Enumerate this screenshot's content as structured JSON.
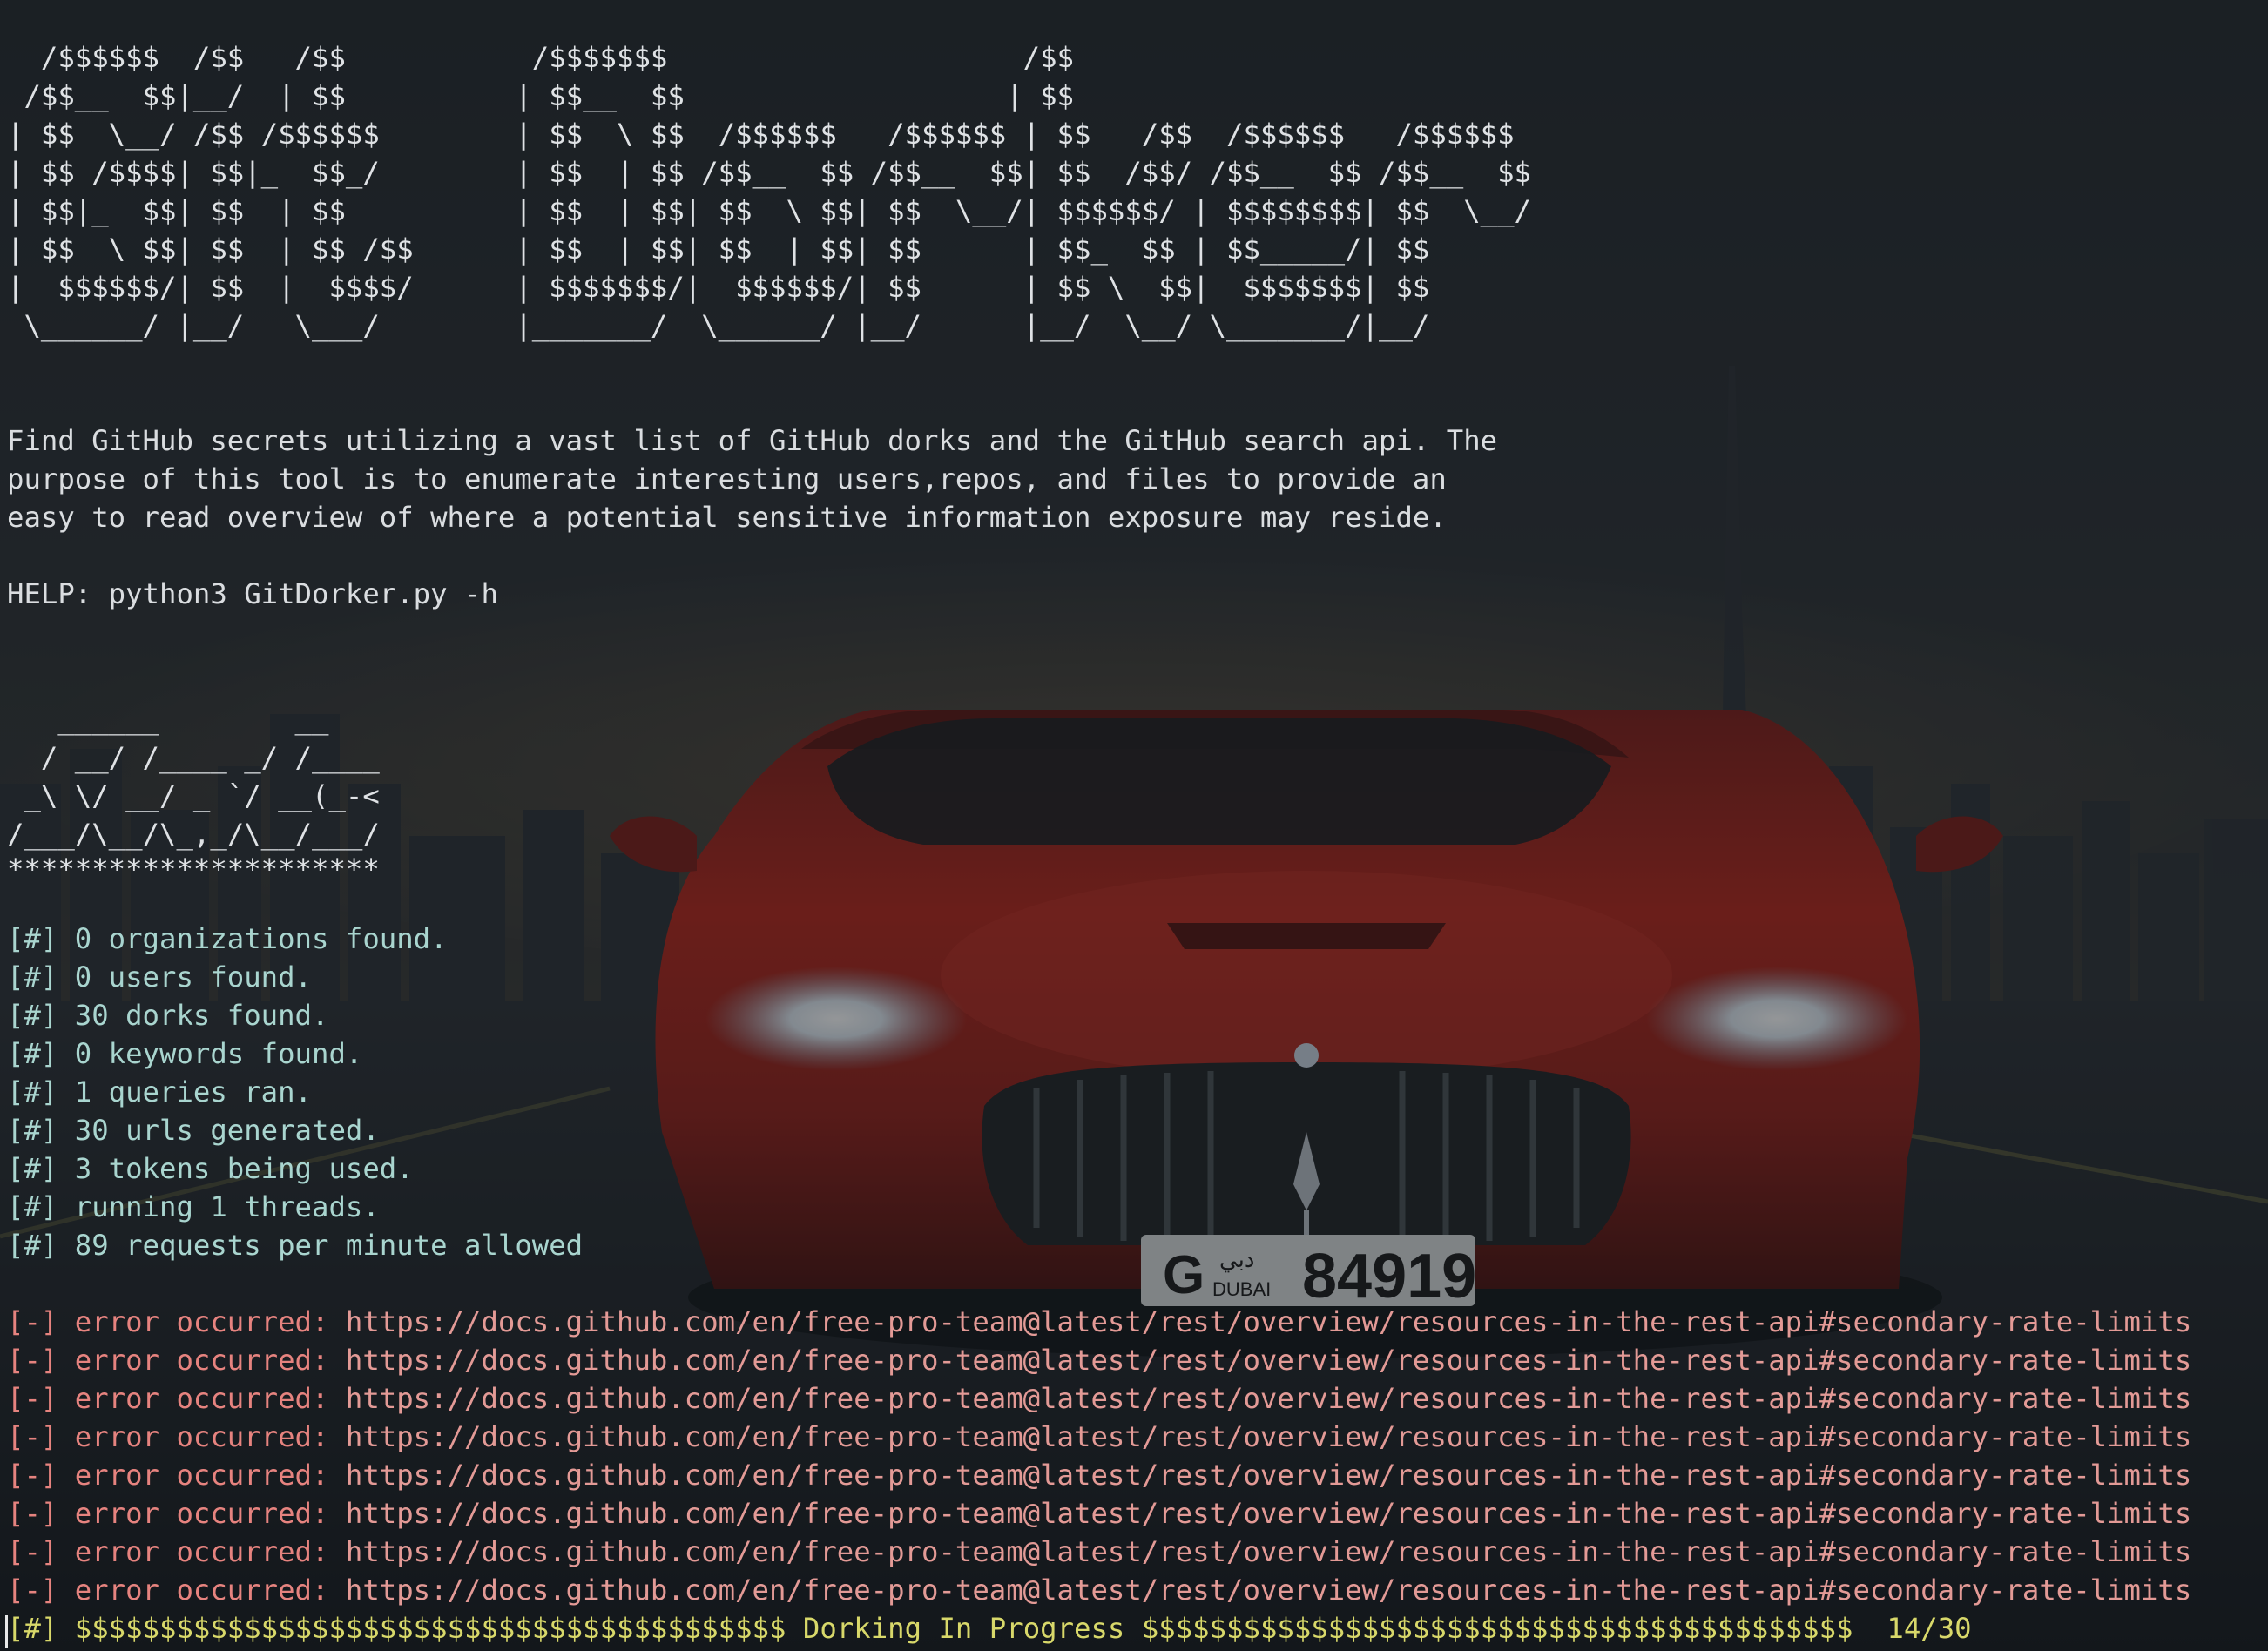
{
  "banner": {
    "lines": [
      "  /$$$$$$  /$$   /$$           /$$$$$$$                     /$$",
      " /$$__  $$|__/  | $$          | $$__  $$                   | $$",
      "| $$  \\__/ /$$ /$$$$$$        | $$  \\ $$  /$$$$$$   /$$$$$$ | $$   /$$  /$$$$$$   /$$$$$$",
      "| $$ /$$$$| $$|_  $$_/        | $$  | $$ /$$__  $$ /$$__  $$| $$  /$$/ /$$__  $$ /$$__  $$",
      "| $$|_  $$| $$  | $$          | $$  | $$| $$  \\ $$| $$  \\__/| $$$$$$/ | $$$$$$$$| $$  \\__/",
      "| $$  \\ $$| $$  | $$ /$$      | $$  | $$| $$  | $$| $$      | $$_  $$ | $$_____/| $$",
      "|  $$$$$$/| $$  |  $$$$/      | $$$$$$$/|  $$$$$$/| $$      | $$ \\  $$|  $$$$$$$| $$",
      " \\______/ |__/   \\___/        |_______/  \\______/ |__/      |__/  \\__/ \\_______/|__/"
    ]
  },
  "description": {
    "lines": [
      "Find GitHub secrets utilizing a vast list of GitHub dorks and the GitHub search api. The",
      "purpose of this tool is to enumerate interesting users,repos, and files to provide an",
      "easy to read overview of where a potential sensitive information exposure may reside."
    ]
  },
  "help": "HELP: python3 GitDorker.py -h",
  "setup_banner": {
    "lines": [
      "   ______        __",
      "  / __/ /____ _/ /____",
      " _\\ \\/ __/ _ `/ __(_-<",
      "/___/\\__/\\_,_/\\__/___/",
      "**********************"
    ]
  },
  "stats": [
    "[#] 0 organizations found.",
    "[#] 0 users found.",
    "[#] 30 dorks found.",
    "[#] 0 keywords found.",
    "[#] 1 queries ran.",
    "[#] 30 urls generated.",
    "[#] 3 tokens being used.",
    "[#] running 1 threads.",
    "[#] 89 requests per minute allowed"
  ],
  "errors": [
    {
      "prefix": "[-] error occurred: ",
      "url": "https://docs.github.com/en/free-pro-team@latest/rest/overview/resources-in-the-rest-api#secondary-rate-limits"
    },
    {
      "prefix": "[-] error occurred: ",
      "url": "https://docs.github.com/en/free-pro-team@latest/rest/overview/resources-in-the-rest-api#secondary-rate-limits"
    },
    {
      "prefix": "[-] error occurred: ",
      "url": "https://docs.github.com/en/free-pro-team@latest/rest/overview/resources-in-the-rest-api#secondary-rate-limits"
    },
    {
      "prefix": "[-] error occurred: ",
      "url": "https://docs.github.com/en/free-pro-team@latest/rest/overview/resources-in-the-rest-api#secondary-rate-limits"
    },
    {
      "prefix": "[-] error occurred: ",
      "url": "https://docs.github.com/en/free-pro-team@latest/rest/overview/resources-in-the-rest-api#secondary-rate-limits"
    },
    {
      "prefix": "[-] error occurred: ",
      "url": "https://docs.github.com/en/free-pro-team@latest/rest/overview/resources-in-the-rest-api#secondary-rate-limits"
    },
    {
      "prefix": "[-] error occurred: ",
      "url": "https://docs.github.com/en/free-pro-team@latest/rest/overview/resources-in-the-rest-api#secondary-rate-limits"
    },
    {
      "prefix": "[-] error occurred: ",
      "url": "https://docs.github.com/en/free-pro-team@latest/rest/overview/resources-in-the-rest-api#secondary-rate-limits"
    }
  ],
  "progress": {
    "tag": "[#]",
    "left_bar": "$$$$$$$$$$$$$$$$$$$$$$$$$$$$$$$$$$$$$$$$$$",
    "label": "Dorking In Progress",
    "right_bar": "$$$$$$$$$$$$$$$$$$$$$$$$$$$$$$$$$$$$$$$$$$",
    "count": "14/30",
    "completed": 14,
    "total": 30
  },
  "background": {
    "plate_letter": "G",
    "plate_city": "DUBAI",
    "plate_arabic": "دبي",
    "plate_number": "84919"
  },
  "colors": {
    "background": "#1c2127",
    "banner_text": "#dfe2e5",
    "stat_text": "#a9d5cf",
    "error_text": "#e6837f",
    "progress_text": "#d8d86a",
    "car_red": "#b3261b"
  }
}
